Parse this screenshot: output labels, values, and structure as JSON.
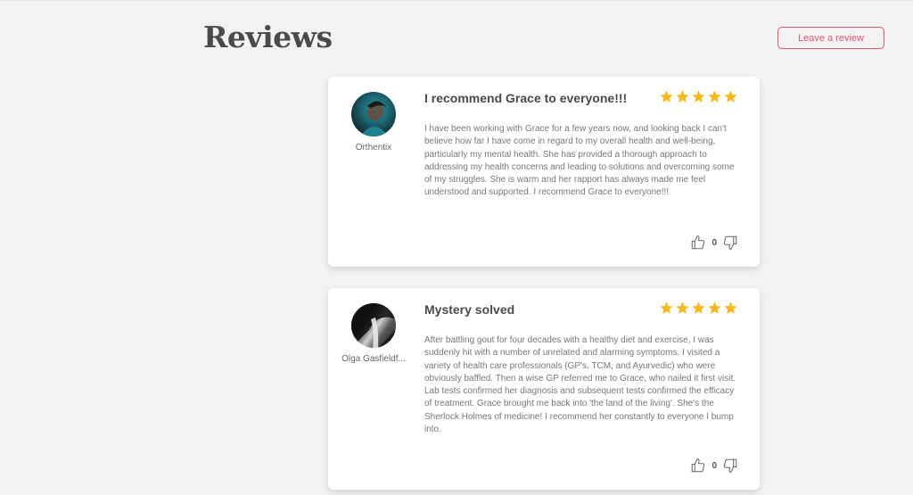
{
  "page": {
    "title": "Reviews",
    "leave_review_label": "Leave a review"
  },
  "colors": {
    "accent": "#e0566f",
    "star": "#f5b820",
    "background": "#f2f2f2"
  },
  "reviews": [
    {
      "author": "Orthentix",
      "title": "I recommend Grace to everyone!!!",
      "rating": 5,
      "body": "I have been working with Grace for a few years now, and looking back I can't believe how far I have come in regard to my overall health and well-being, particularly my mental health. She has provided a thorough approach to addressing my health concerns and leading to solutions and overcoming some of my struggles. She is warm and her rapport has always made me feel understood and supported. I recommend Grace to everyone!!!",
      "like_count": "0",
      "icons": [
        "thumbs-up-icon",
        "thumbs-down-icon"
      ]
    },
    {
      "author": "Olga Gasfieldf...",
      "title": "Mystery solved",
      "rating": 5,
      "body": "After battling gout for four decades with a healthy diet and exercise, I was suddenly hit with a number of unrelated and alarming symptoms. I visited a variety of health care professionals (GP's, TCM, and Ayurvedic) who were obviously baffled. Then a wise GP referred me to Grace, who nailed it first visit. Lab tests confirmed her diagnosis and subsequent tests confirmed the efficacy of treatment. Grace brought me back into 'the land of the living'. She's the Sherlock Holmes of medicine! I recommend her constantly to everyone I bump into.",
      "like_count": "0",
      "icons": [
        "thumbs-up-icon",
        "thumbs-down-icon"
      ]
    }
  ]
}
